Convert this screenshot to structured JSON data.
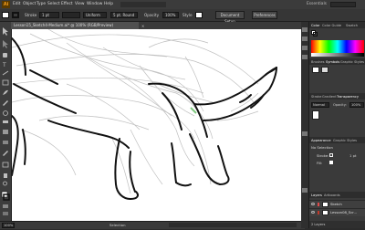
{
  "menu": {
    "logo": "Ai",
    "items": [
      "Edit",
      "Object",
      "Type",
      "Select",
      "Effect",
      "View",
      "Window",
      "Help"
    ],
    "essentials": "Essentials"
  },
  "control": {
    "stroke_label": "Stroke",
    "stroke_weight": "1 pt",
    "profile_value": "Uniform",
    "brush_value": "5 pt. Round",
    "opacity_label": "Opacity",
    "opacity_value": "100%",
    "style_label": "Style",
    "doc_setup": "Document Setup",
    "preferences": "Preferences"
  },
  "document": {
    "tab_title": "Lesson15_Sketch4-Medium.ai* @ 100% (RGB/Preview)",
    "zoom": "100%",
    "status_tool": "Selection"
  },
  "panels": {
    "top_tabs": [
      "Color",
      "Color Guide",
      "Swatch"
    ],
    "mid_tabs": [
      "Brushes",
      "Symbols",
      "Graphic Styles"
    ],
    "transp_tabs": [
      "Stroke",
      "Gradient",
      "Transparency"
    ],
    "blend_mode": "Normal",
    "opacity_label": "Opacity:",
    "opacity_value": "100%",
    "appearance_tabs": [
      "Appearance",
      "Graphic Styles"
    ],
    "appearance_title": "No Selection",
    "stroke_label": "Stroke:",
    "stroke_value": "1 pt",
    "fill_label": "Fill:",
    "layers_tabs": [
      "Layers",
      "Artboards"
    ],
    "layers": [
      {
        "name": "Sketch",
        "color": "#e04a4a"
      },
      {
        "name": "Lesson08_Scr...",
        "color": "#c0392b"
      }
    ],
    "layers_count": "2 Layers"
  },
  "colors": {
    "accent_orange": "#f29b1c",
    "canvas_bg": "#ffffff"
  }
}
